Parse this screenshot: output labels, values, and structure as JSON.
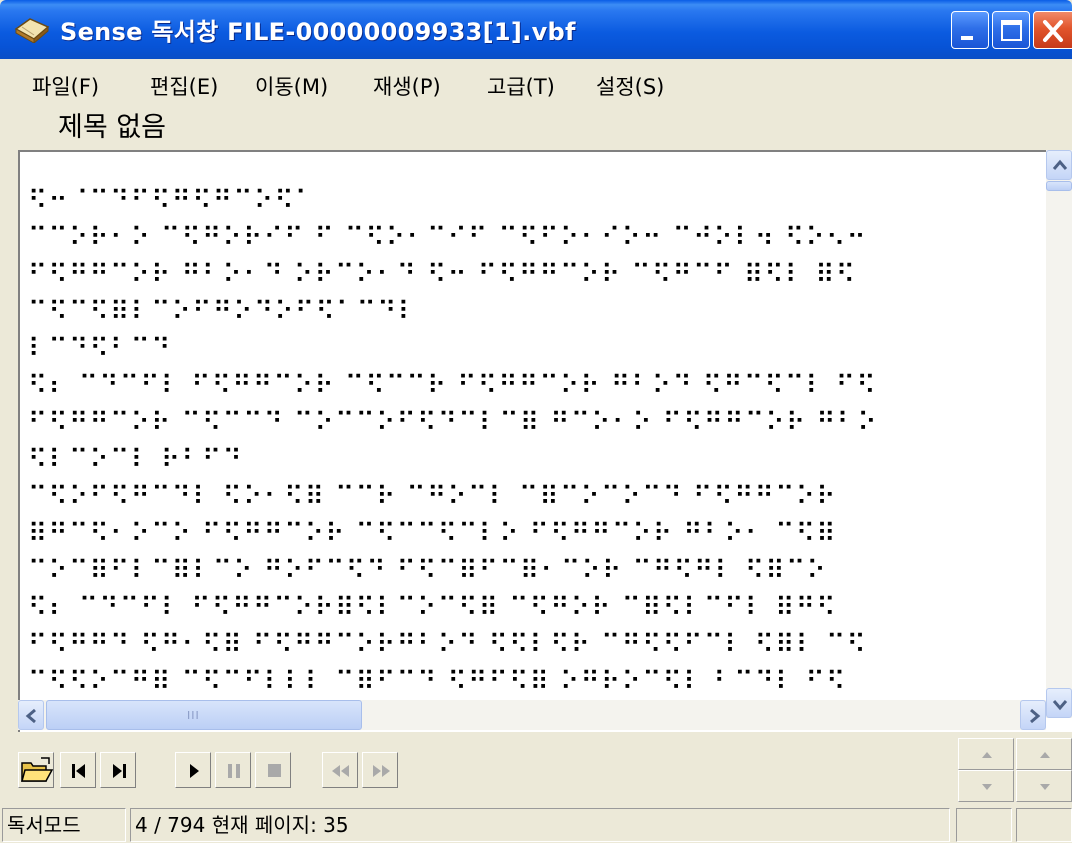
{
  "window": {
    "title": "Sense 독서창 FILE-00000009933[1].vbf"
  },
  "menu": [
    {
      "label": "파일(F)"
    },
    {
      "label": "편집(E)"
    },
    {
      "label": "이동(M)"
    },
    {
      "label": "재생(P)"
    },
    {
      "label": "고급(T)"
    },
    {
      "label": "설정(S)"
    }
  ],
  "document": {
    "title": "제목 없음",
    "braille_lines": [
      "⠫⠒⠈⠉⠙⠋⠫⠛⠫⠛⠉⠕⠫⠁",
      "⠉⠉⠕⠗⠂⠕ ⠉⠫⠛⠕⠗⠊⠋ ⠋ ⠉⠫⠕⠂⠉⠊⠋ ⠉⠫⠋⠕⠂⠊⠕⠒ ⠉⠚⠕⠇⠲ ⠫⠕⠢⠒",
      "⠋⠫⠛⠛⠉⠕⠗ ⠛⠃⠕⠂⠙ ⠕⠗⠉⠕⠂⠙ ⠫⠒ ⠋⠫⠛⠛⠉⠕⠗ ⠉⠫⠛⠉⠋ ⠿⠫⠇ ⠿⠫",
      "⠉⠫⠉⠫⠿⠇⠉⠕⠋⠛⠕⠙⠕⠋⠫⠁⠉⠙⠇",
      "⠇⠉⠙⠫⠃⠉⠙",
      "⠫⠆ ⠉⠙⠉⠋⠇ ⠋⠫⠛⠛⠉⠕⠗ ⠉⠫⠉⠉⠗ ⠋⠫⠛⠛⠉⠕⠗ ⠛⠃⠕⠙ ⠫⠛⠉⠫⠉⠇ ⠋⠫",
      "⠋⠫⠛⠛⠉⠕⠗ ⠉⠫⠉⠉⠙ ⠉⠕⠉⠉⠕⠋⠫⠙⠉⠇⠉⠿ ⠛⠉⠕⠂⠕ ⠋⠫⠛⠛⠉⠕⠗ ⠛⠃⠕",
      "⠫⠇⠉⠕⠉⠇ ⠗⠃⠋⠙",
      "⠉⠫⠕⠋⠫⠛⠉⠙⠇ ⠫⠕⠂⠫⠿ ⠉⠉⠗ ⠉⠛⠕⠉⠇ ⠉⠿⠉⠕⠉⠕⠉⠙ ⠋⠫⠛⠛⠉⠕⠗",
      "⠿⠛⠉⠫⠂⠕⠉⠕ ⠋⠫⠛⠛⠉⠕⠗ ⠉⠫⠉⠉⠫⠉⠇⠕ ⠋⠫⠛⠛⠉⠕⠗ ⠛⠃⠕⠂ ⠉⠫⠿",
      "⠉⠕⠉⠿⠋⠇⠉⠿⠇⠉⠕ ⠛⠕⠋⠉⠫⠙ ⠋⠫⠉⠿⠋⠉⠿⠂⠉⠕⠗ ⠉⠛⠫⠛⠇ ⠫⠿⠉⠕",
      "⠫⠆ ⠉⠙⠉⠋⠇ ⠋⠫⠛⠛⠉⠕⠗⠿⠫⠇⠉⠕⠉⠫⠿ ⠉⠫⠛⠕⠗ ⠉⠿⠫⠇⠉⠋⠇ ⠿⠛⠫",
      "⠋⠫⠛⠛⠙ ⠫⠛⠂⠫⠿ ⠋⠫⠛⠛⠉⠕⠗⠛⠃⠕⠙ ⠫⠫⠇⠫⠗ ⠉⠛⠫⠫⠋⠉⠇ ⠫⠿⠇ ⠉⠫",
      "⠉⠫⠫⠕⠉⠛⠿ ⠉⠫⠉⠋⠇⠇⠇ ⠉⠿⠋⠉⠙ ⠫⠛⠋⠫⠿ ⠕⠛⠗⠕⠉⠫⠇ ⠃⠉⠙⠇ ⠋⠫"
    ]
  },
  "scrollbar": {
    "grip": "III"
  },
  "toolbar": {
    "buttons": [
      "open",
      "prev-page",
      "next-page",
      "play",
      "pause",
      "stop",
      "rewind",
      "fast-forward"
    ]
  },
  "status": {
    "mode": "독서모드",
    "position": "4 / 794  현재 페이지: 35"
  }
}
